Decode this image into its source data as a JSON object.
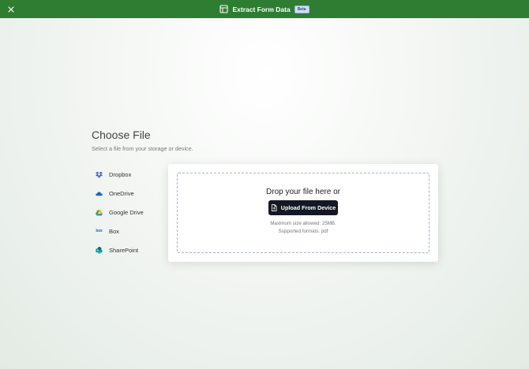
{
  "header": {
    "title": "Extract Form Data",
    "badge": "Beta",
    "close_icon": "close-icon",
    "form_icon": "form-icon",
    "bar_color": "#2e7d32"
  },
  "page": {
    "heading": "Choose File",
    "subheading": "Select a file from your storage or device."
  },
  "sources": {
    "items": [
      {
        "label": "Dropbox",
        "icon": "dropbox-icon",
        "color": "#2f5fd0"
      },
      {
        "label": "OneDrive",
        "icon": "onedrive-icon",
        "color": "#1e60c8"
      },
      {
        "label": "Google Drive",
        "icon": "google-drive-icon",
        "color": "#34a853"
      },
      {
        "label": "Box",
        "icon": "box-icon",
        "color": "#1b6bd1",
        "logo_text": "box"
      },
      {
        "label": "SharePoint",
        "icon": "sharepoint-icon",
        "color": "#0b7a75"
      }
    ]
  },
  "upload": {
    "drop_text": "Drop your file here or",
    "button_label": "Upload From Device",
    "button_icon": "file-icon",
    "size_limit": "Maximum size allowed: 25MB.",
    "formats": "Supported formats: pdf"
  }
}
